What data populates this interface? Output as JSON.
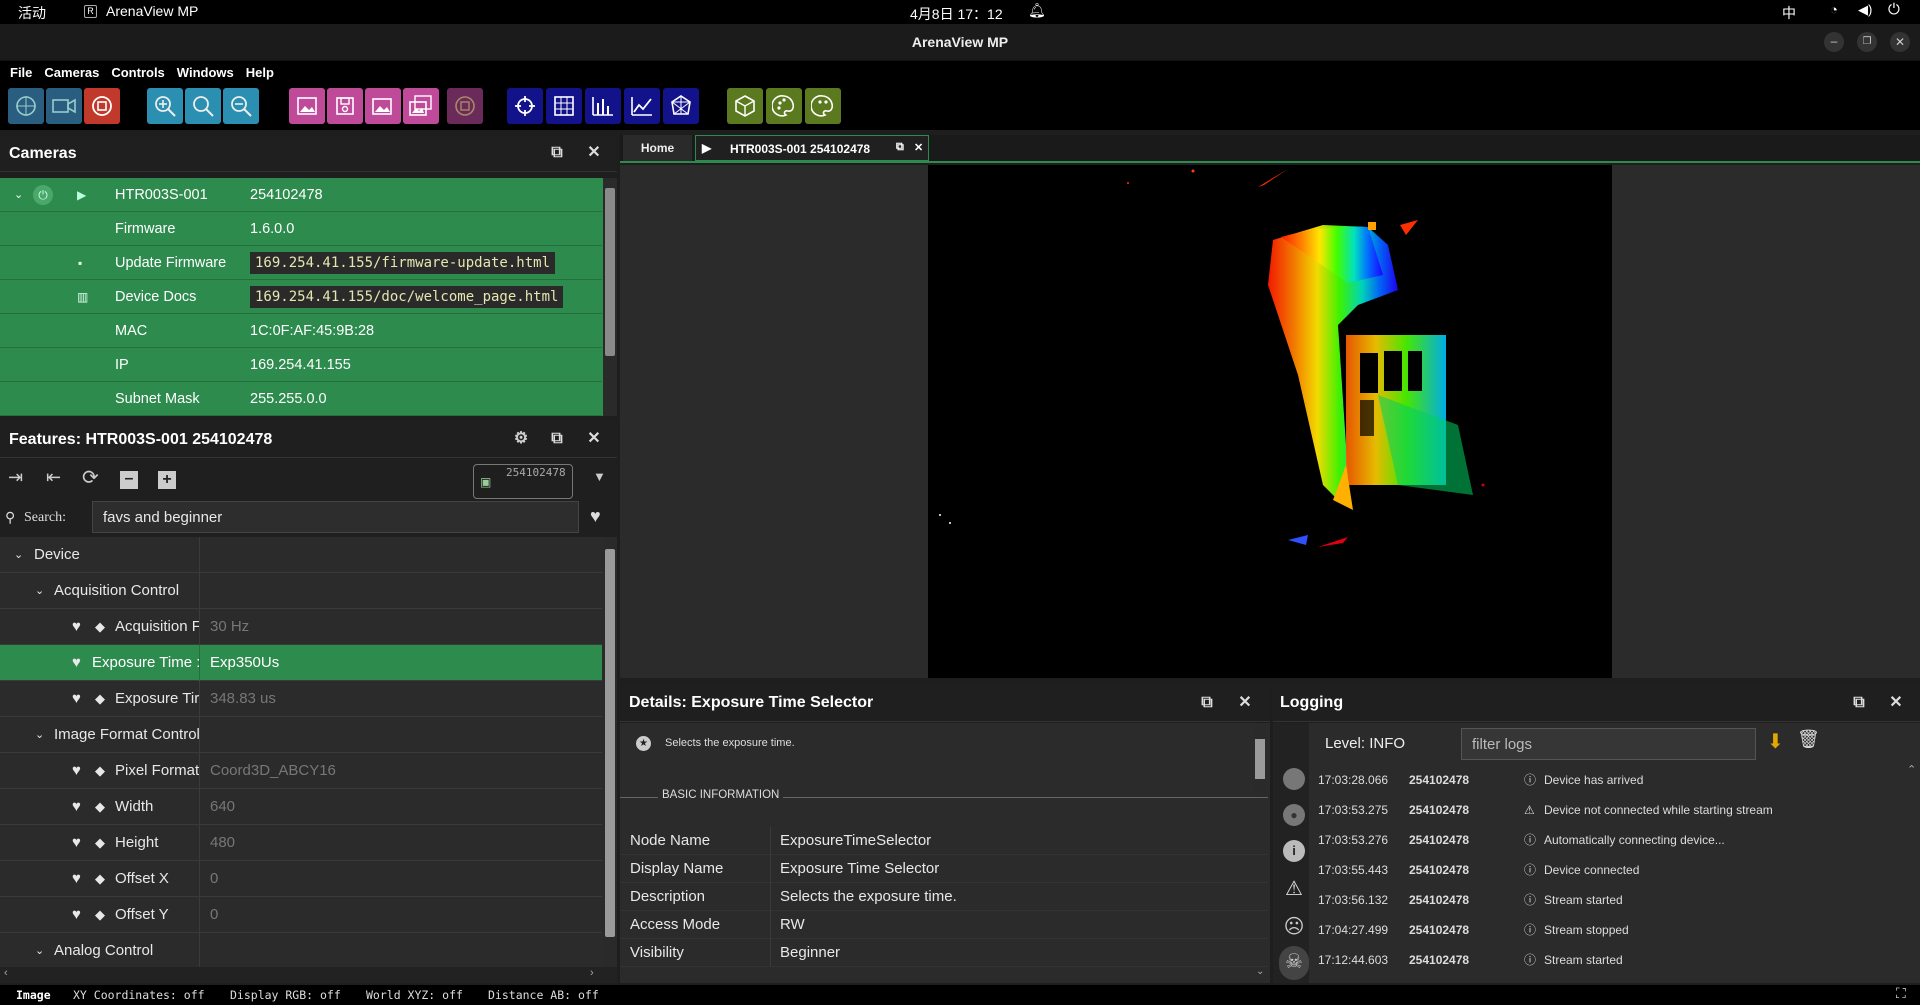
{
  "system": {
    "activities": "活动",
    "app_name": "ArenaView MP",
    "datetime": "4月8日  17：12",
    "ime": "中"
  },
  "window": {
    "title": "ArenaView MP"
  },
  "menu": [
    "File",
    "Cameras",
    "Controls",
    "Windows",
    "Help"
  ],
  "toolbar": {
    "icons": [
      "crosshair-circle-icon",
      "video-camera-icon",
      "stop-record-icon",
      "zoom-fit-icon",
      "zoom-icon",
      "zoom-out-icon",
      "image-icon",
      "save-image-icon",
      "images-icon",
      "multi-image-icon",
      "stop-circle-icon",
      "target-icon",
      "grid-icon",
      "histogram-icon",
      "line-chart-icon",
      "polygon-icon",
      "cube-icon",
      "palette-icon",
      "palette-alt-icon"
    ],
    "colors": {
      "blue": "#2a5e80",
      "pink": "#c04a9a",
      "navy": "#12128a",
      "olive": "#5b7a1f",
      "red": "#c0392b"
    }
  },
  "cameras_panel": {
    "title": "Cameras",
    "rows": [
      {
        "label": "HTR003S-001",
        "value": "254102478"
      },
      {
        "label": "Firmware",
        "value": "1.6.0.0"
      },
      {
        "label": "Update Firmware",
        "value": "169.254.41.155/firmware-update.html",
        "link": true
      },
      {
        "label": "Device Docs",
        "value": "169.254.41.155/doc/welcome_page.html",
        "link": true
      },
      {
        "label": "MAC",
        "value": "1C:0F:AF:45:9B:28"
      },
      {
        "label": "IP",
        "value": "169.254.41.155"
      },
      {
        "label": "Subnet Mask",
        "value": "255.255.0.0"
      }
    ]
  },
  "features_panel": {
    "title": "Features: HTR003S-001 254102478",
    "device_badge": "254102478",
    "search_label": "Search:",
    "search_value": "favs and beginner",
    "rows": [
      {
        "name": "Device",
        "value": "",
        "level": 0,
        "group": true
      },
      {
        "name": "Acquisition Control",
        "value": "",
        "level": 1,
        "group": true
      },
      {
        "name": "Acquisition F",
        "value": "30 Hz",
        "level": 2
      },
      {
        "name": "Exposure Time :",
        "value": "Exp350Us",
        "level": 2,
        "selected": true
      },
      {
        "name": "Exposure Tir",
        "value": "348.83 us",
        "level": 2
      },
      {
        "name": "Image Format Control",
        "value": "",
        "level": 1,
        "group": true
      },
      {
        "name": "Pixel Format",
        "value": "Coord3D_ABCY16",
        "level": 2
      },
      {
        "name": "Width",
        "value": "640",
        "level": 2
      },
      {
        "name": "Height",
        "value": "480",
        "level": 2
      },
      {
        "name": "Offset X",
        "value": "0",
        "level": 2
      },
      {
        "name": "Offset Y",
        "value": "0",
        "level": 2
      },
      {
        "name": "Analog Control",
        "value": "",
        "level": 1,
        "group": true
      }
    ]
  },
  "tabs": {
    "home": "Home",
    "stream": "HTR003S-001 254102478"
  },
  "details_panel": {
    "title": "Details: Exposure Time Selector",
    "description": "Selects the exposure time.",
    "section": "BASIC INFORMATION",
    "rows": [
      {
        "k": "Node Name",
        "v": "ExposureTimeSelector"
      },
      {
        "k": "Display Name",
        "v": "Exposure Time Selector"
      },
      {
        "k": "Description",
        "v": "Selects the exposure time."
      },
      {
        "k": "Access Mode",
        "v": "RW"
      },
      {
        "k": "Visibility",
        "v": "Beginner"
      }
    ]
  },
  "logging_panel": {
    "title": "Logging",
    "level": "Level: INFO",
    "filter_placeholder": "filter logs",
    "entries": [
      {
        "time": "17:03:28.066",
        "device": "254102478",
        "icon": "info-icon",
        "msg": "Device has arrived"
      },
      {
        "time": "17:03:53.275",
        "device": "254102478",
        "icon": "warning-icon",
        "msg": "Device not connected while starting stream"
      },
      {
        "time": "17:03:53.276",
        "device": "254102478",
        "icon": "info-icon",
        "msg": "Automatically connecting device..."
      },
      {
        "time": "17:03:55.443",
        "device": "254102478",
        "icon": "info-icon",
        "msg": "Device connected"
      },
      {
        "time": "17:03:56.132",
        "device": "254102478",
        "icon": "info-icon",
        "msg": "Stream started"
      },
      {
        "time": "17:04:27.499",
        "device": "254102478",
        "icon": "info-icon",
        "msg": "Stream stopped"
      },
      {
        "time": "17:12:44.603",
        "device": "254102478",
        "icon": "info-icon",
        "msg": "Stream started"
      }
    ]
  },
  "statusbar": {
    "mode": "Image",
    "xy": "XY Coordinates: off",
    "rgb": "Display RGB: off",
    "world": "World XYZ: off",
    "distance": "Distance AB: off"
  }
}
